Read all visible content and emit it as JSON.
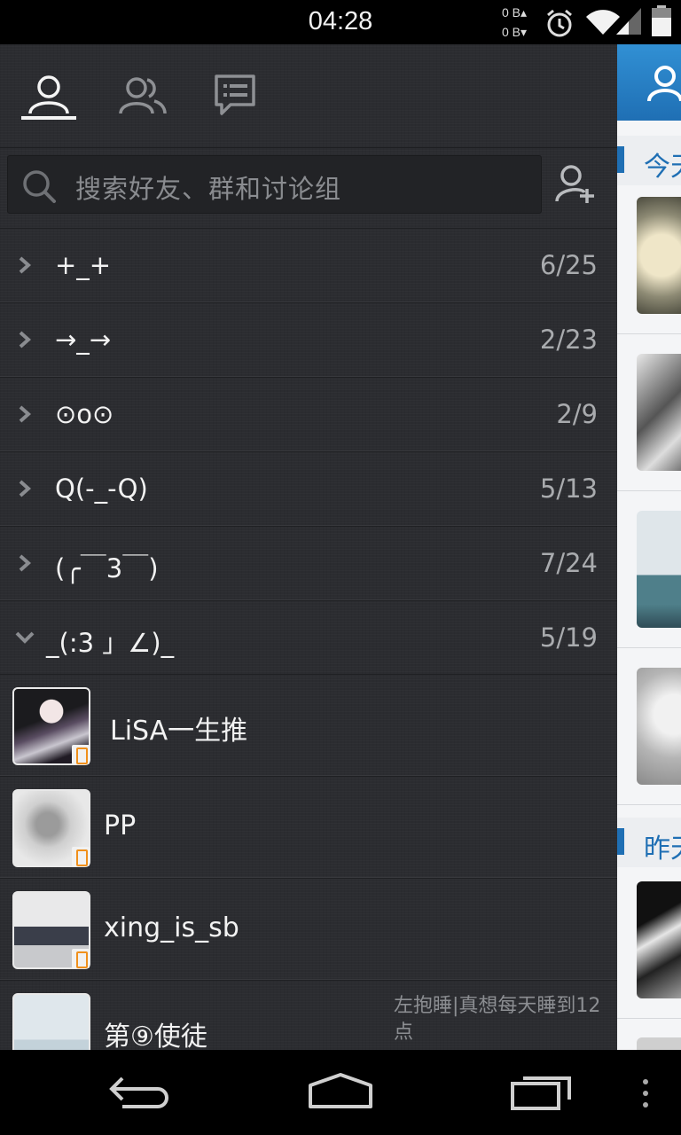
{
  "status_bar": {
    "time": "04:28",
    "net_up": "0 B▴",
    "net_down": "0 B▾",
    "icons": [
      "alarm-icon",
      "wifi-icon",
      "signal-icon",
      "battery-icon"
    ]
  },
  "tabs": [
    {
      "name": "contacts",
      "icon": "person-icon",
      "active": true
    },
    {
      "name": "groups",
      "icon": "people-icon",
      "active": false
    },
    {
      "name": "discussions",
      "icon": "chat-list-icon",
      "active": false
    }
  ],
  "search": {
    "placeholder": "搜索好友、群和讨论组"
  },
  "groups": [
    {
      "name": " +_+",
      "count": "6/25",
      "expanded": false
    },
    {
      "name": "→_→",
      "count": "2/23",
      "expanded": false
    },
    {
      "name": "⊙o⊙",
      "count": "2/9",
      "expanded": false
    },
    {
      "name": "Q(-_-Q)",
      "count": "5/13",
      "expanded": false
    },
    {
      "name": "(╭￣3￣)",
      "count": "7/24",
      "expanded": false
    },
    {
      "name": "_(:3 」∠)_",
      "count": "5/19",
      "expanded": true
    }
  ],
  "contacts": [
    {
      "name": " LiSA一生推",
      "status": ""
    },
    {
      "name": "PP",
      "status": ""
    },
    {
      "name": "xing_is_sb",
      "status": ""
    },
    {
      "name": "第⑨使徒",
      "status": "左抱睡|真想每天睡到12点"
    }
  ],
  "peek": {
    "sections": [
      {
        "label": "今天"
      },
      {
        "label": "昨天"
      }
    ]
  },
  "colors": {
    "accent_blue": "#1f6fb4",
    "drawer_bg": "#2b2c30",
    "badge_orange": "#f0901c"
  }
}
